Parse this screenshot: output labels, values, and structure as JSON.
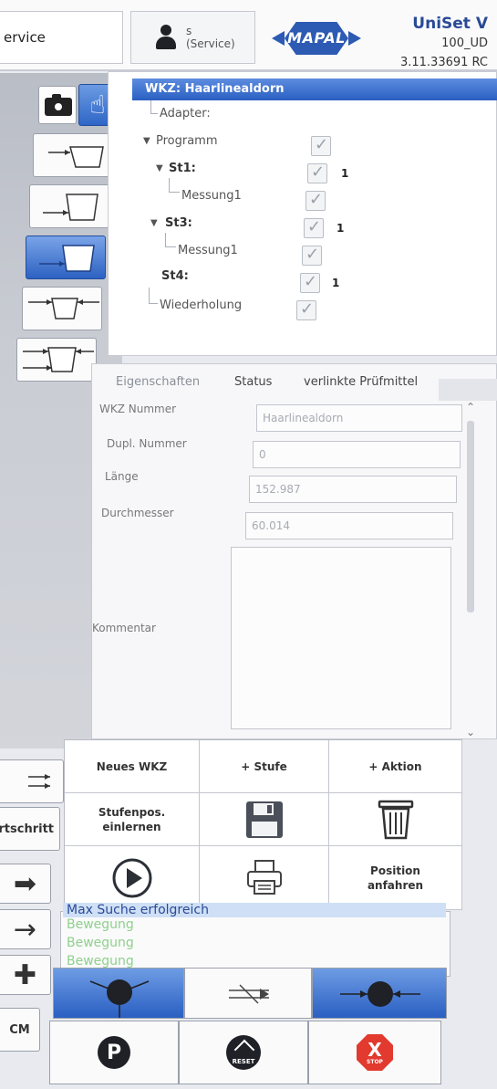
{
  "header": {
    "service_label": "ervice",
    "user_name": "s",
    "user_role": "(Service)",
    "logo_text": "MAPAL",
    "app_name": "UniSet V",
    "machine": "100_UD",
    "version": "3.11.33691 RC"
  },
  "tree": {
    "root_label": "WKZ: Haarlinealdorn",
    "nodes": [
      {
        "label": "Adapter:"
      },
      {
        "label": "Programm"
      },
      {
        "label": "St1:",
        "count": "1"
      },
      {
        "label": "Messung1"
      },
      {
        "label": "St3:",
        "count": "1"
      },
      {
        "label": "Messung1"
      },
      {
        "label": "St4:",
        "count": "1"
      },
      {
        "label": "Wiederholung"
      }
    ]
  },
  "props": {
    "tabs": [
      "Eigenschaften",
      "Status",
      "verlinkte Prüfmittel"
    ],
    "fields": [
      {
        "label": "WKZ Nummer",
        "value": "Haarlinealdorn"
      },
      {
        "label": "Dupl. Nummer",
        "value": "0"
      },
      {
        "label": "Länge",
        "value": "152.987"
      },
      {
        "label": "Durchmesser",
        "value": "60.014"
      }
    ],
    "comment_label": "Kommentar",
    "comment_value": ""
  },
  "actions": {
    "new_tool": "Neues WKZ",
    "add_stage": "+ Stufe",
    "add_action": "+ Aktion",
    "teach_line1": "Stufenpos.",
    "teach_line2": "einlernen",
    "move_line1": "Position",
    "move_line2": "anfahren"
  },
  "log": {
    "messages": [
      "Max Suche erfolgreich",
      "Bewegung",
      "Bewegung",
      "Bewegung"
    ]
  },
  "left": {
    "progress_label": "rtschritt",
    "cm_label": "CM"
  },
  "controls": {
    "p_label": "P",
    "reset_label": "RESET",
    "stop_label": "STOP",
    "stop_symbol": "X"
  },
  "colors": {
    "accent_blue": "#2d62c2",
    "brand_blue": "#2d5bb3",
    "stop_red": "#e23a2e",
    "log_green": "#8fd08c"
  }
}
